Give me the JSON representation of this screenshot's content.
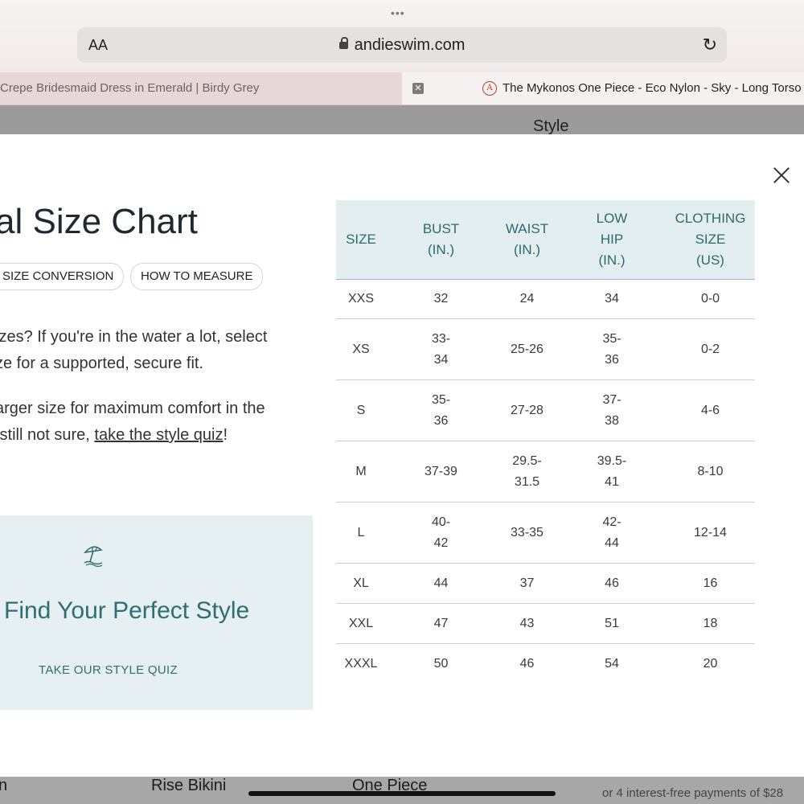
{
  "browser": {
    "menu_dots": "•••",
    "text_size_label": "AA",
    "url": "andieswim.com",
    "icons": {
      "lock": "lock-icon",
      "reload": "reload-icon"
    }
  },
  "tabs": [
    {
      "title": "Crepe Bridesmaid Dress in Emerald | Birdy Grey",
      "active": false
    },
    {
      "title": "The Mykonos One Piece - Eco Nylon - Sky - Long Torso",
      "active": true
    }
  ],
  "background_page": {
    "style_heading": "Style",
    "bottom_labels": [
      "n",
      "Rise Bikini",
      "One Piece"
    ],
    "installments": "or 4 interest-free payments of $28"
  },
  "modal": {
    "title": "al Size Chart",
    "buttons": {
      "size_conversion": "SIZE CONVERSION",
      "how_to_measure": "HOW TO MEASURE"
    },
    "paragraphs": {
      "p1_line1": "izes? If you're in the water a lot, select",
      "p1_line2": "ze for a supported, secure fit.",
      "p2_line1": "arger size for maximum comfort in the",
      "p2_line2_prefix": " still not sure, ",
      "p2_link": "take the style quiz",
      "p2_suffix": "!"
    },
    "promo": {
      "icon": "beach-umbrella-icon",
      "title": "Find Your Perfect Style",
      "link": "TAKE OUR STYLE QUIZ"
    },
    "table": {
      "headers": [
        "SIZE",
        "BUST\n(IN.)",
        "WAIST\n(IN.)",
        "LOW\nHIP\n(IN.)",
        "CLOTHING\nSIZE\n(US)"
      ],
      "rows": [
        [
          "XXS",
          "32",
          "24",
          "34",
          "0-0"
        ],
        [
          "XS",
          "33-\n34",
          "25-26",
          "35-\n36",
          "0-2"
        ],
        [
          "S",
          "35-\n36",
          "27-28",
          "37-\n38",
          "4-6"
        ],
        [
          "M",
          "37-39",
          "29.5-\n31.5",
          "39.5-\n41",
          "8-10"
        ],
        [
          "L",
          "40-\n42",
          "33-35",
          "42-\n44",
          "12-14"
        ],
        [
          "XL",
          "44",
          "37",
          "46",
          "16"
        ],
        [
          "XXL",
          "47",
          "43",
          "51",
          "18"
        ],
        [
          "XXXL",
          "50",
          "46",
          "54",
          "20"
        ]
      ]
    },
    "colors": {
      "accent": "#2f6f72",
      "header_bg": "#e3eef1",
      "promo_bg": "#e6eff1"
    }
  }
}
